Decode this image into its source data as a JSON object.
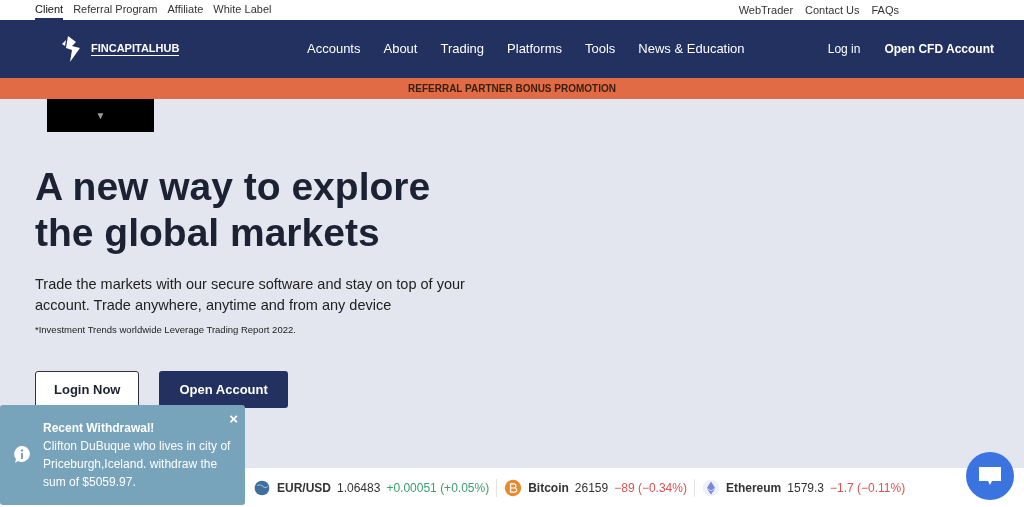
{
  "top_links": [
    {
      "label": "Client",
      "selected": true
    },
    {
      "label": "Referral Program",
      "selected": false
    },
    {
      "label": "Affiliate",
      "selected": false
    },
    {
      "label": "White Label",
      "selected": false
    }
  ],
  "top_right_links": [
    "WebTrader",
    "Contact Us",
    "FAQs"
  ],
  "logo": {
    "text": "FINCAPITALHUB"
  },
  "nav": [
    "Accounts",
    "About",
    "Trading",
    "Platforms",
    "Tools",
    "News & Education"
  ],
  "nav_right": {
    "login": "Log in",
    "open_account": "Open CFD Account"
  },
  "banner": "REFERRAL PARTNER BONUS PROMOTION",
  "dropdown": {
    "caret": "▼"
  },
  "hero": {
    "title": "A new way to explore the global markets",
    "text": "Trade the markets with our secure software and stay on top of your account. Trade anywhere, anytime and from any device",
    "footnote": "*Investment Trends worldwide Leverage Trading Report 2022.",
    "buttons": [
      {
        "kind": "outline",
        "label": "Login Now"
      },
      {
        "kind": "solid",
        "label": "Open Account"
      }
    ]
  },
  "ticker": [
    {
      "kind": "globe",
      "name": "EUR/USD",
      "price": "1.06483",
      "change": "+0.00051 (+0.05%)",
      "color": "#3aa16a"
    },
    {
      "kind": "bitcoin",
      "name": "Bitcoin",
      "price": "26159",
      "change": "−89 (−0.34%)",
      "color": "#d9534f"
    },
    {
      "kind": "ethereum",
      "name": "Ethereum",
      "price": "1579.3",
      "change": "−1.7 (−0.11%)",
      "color": "#d9534f"
    }
  ],
  "notification": {
    "title": "Recent Withdrawal!",
    "text": "Clifton DuBuque who lives in city of Priceburgh,Iceland. withdraw the sum of $5059.97.",
    "close": "×"
  }
}
